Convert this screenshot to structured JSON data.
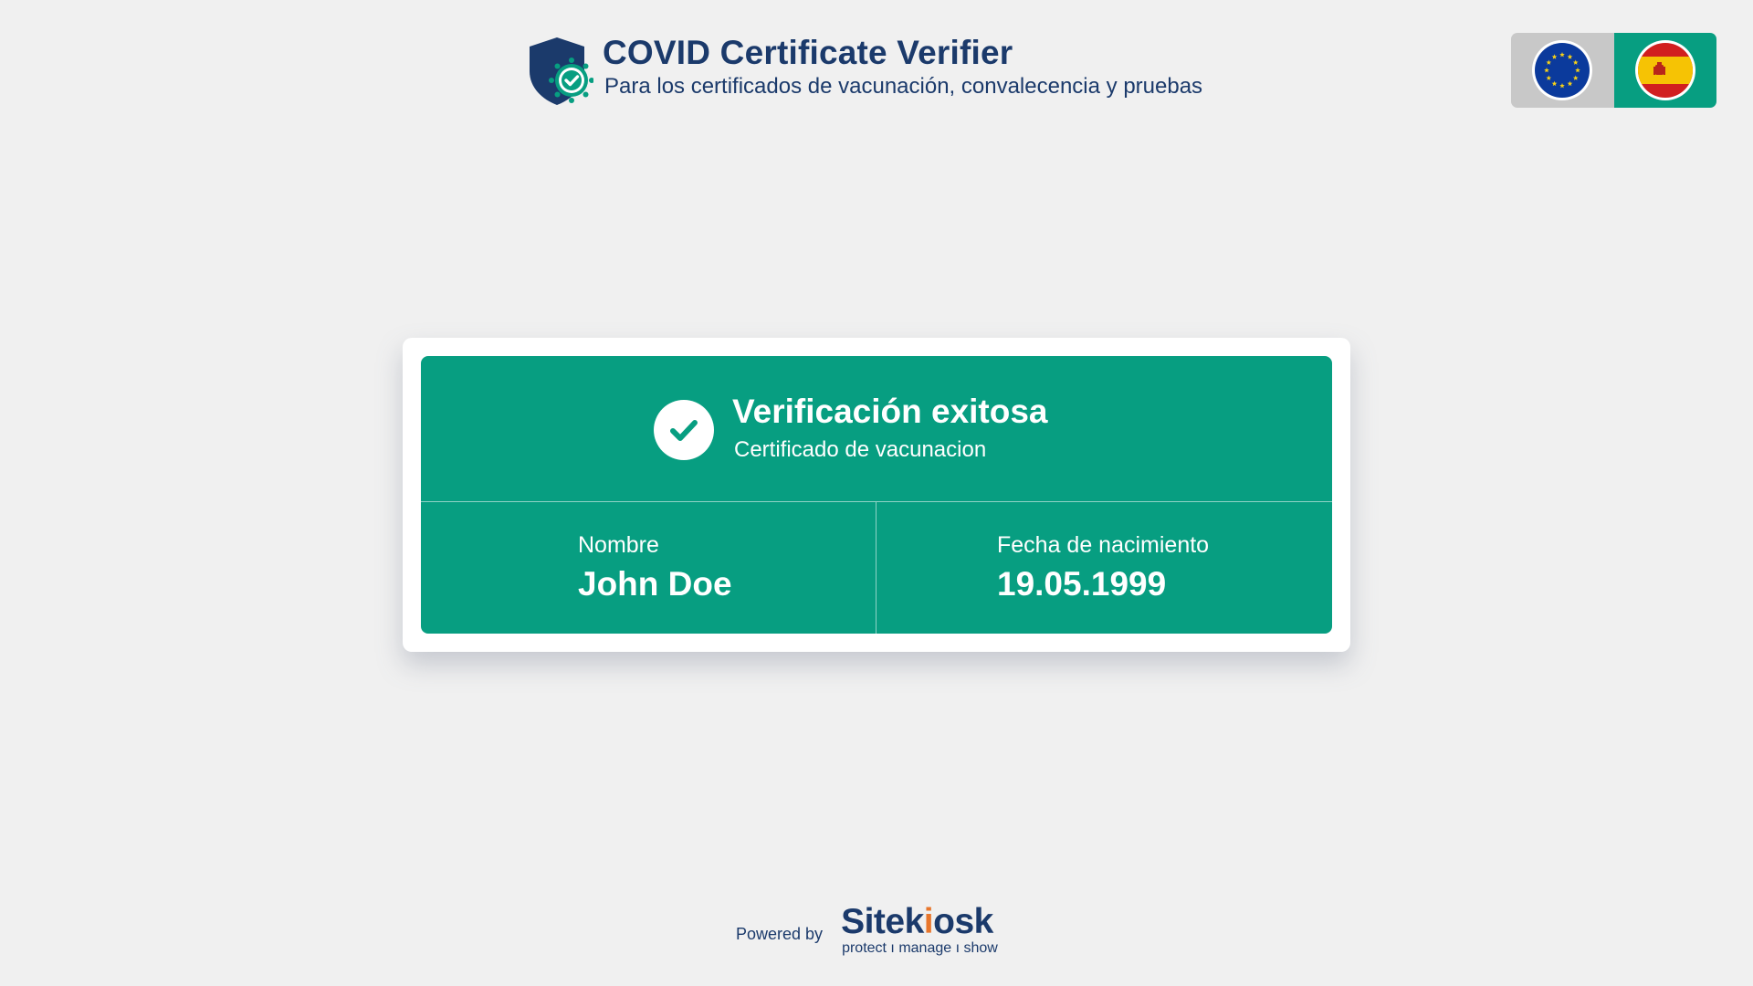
{
  "header": {
    "title": "COVID Certificate Verifier",
    "subtitle": "Para los certificados de vacunación, convalecencia y pruebas",
    "logo_icon": "shield-check-icon"
  },
  "language_switcher": {
    "options": [
      {
        "icon": "eu-flag-icon",
        "selected": false
      },
      {
        "icon": "spain-flag-icon",
        "selected": true
      }
    ]
  },
  "result": {
    "status_icon": "check-circle-icon",
    "title": "Verificación exitosa",
    "subtitle": "Certificado de vacunacion",
    "fields": [
      {
        "label": "Nombre",
        "value": "John Doe"
      },
      {
        "label": "Fecha de nacimiento",
        "value": "19.05.1999"
      }
    ]
  },
  "footer": {
    "powered_by": "Powered by",
    "brand_prefix": "Sitek",
    "brand_accent": "i",
    "brand_suffix": "osk",
    "tagline": "protect  ı  manage  ı  show"
  },
  "colors": {
    "background": "#f0f0f0",
    "brand_navy": "#1b3a6b",
    "success_green": "#079e81",
    "inactive_gray": "#c8c8c8",
    "accent_orange": "#e8762c"
  }
}
